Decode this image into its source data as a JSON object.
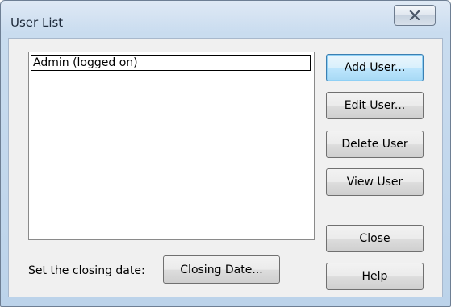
{
  "window": {
    "title": "User List",
    "close_icon": "close-x-icon"
  },
  "users": [
    {
      "label": "Admin (logged on)",
      "selected": true
    }
  ],
  "buttons": {
    "add_user": "Add User...",
    "edit_user": "Edit User...",
    "delete_user": "Delete User",
    "view_user": "View User",
    "close": "Close",
    "help": "Help",
    "closing_date": "Closing Date..."
  },
  "closing_date_label": "Set the closing date:"
}
